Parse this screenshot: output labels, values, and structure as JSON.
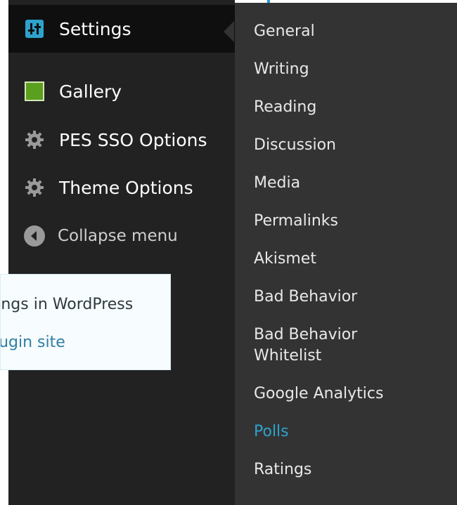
{
  "menu": {
    "items": [
      {
        "label": "Settings",
        "icon": "settings-sliders-icon",
        "active": true
      },
      {
        "label": "Gallery",
        "icon": "gallery-icon",
        "active": false
      },
      {
        "label": "PES SSO Options",
        "icon": "gear-icon",
        "active": false
      },
      {
        "label": "Theme Options",
        "icon": "gear-icon",
        "active": false
      }
    ],
    "collapse_label": "Collapse menu"
  },
  "submenu": {
    "items": [
      "General",
      "Writing",
      "Reading",
      "Discussion",
      "Media",
      "Permalinks",
      "Akismet",
      "Bad Behavior",
      "Bad Behavior",
      "Whitelist",
      "Google Analytics",
      "Polls",
      "Ratings"
    ],
    "current": "Polls"
  },
  "tooltip": {
    "text": "ttings in WordPress",
    "link": "plugin site"
  },
  "colors": {
    "menu_bg": "#222222",
    "active_bg": "#0f0f10",
    "submenu_bg": "#333333",
    "accent": "#2ea2cc",
    "tooltip_bg": "#f7fcfe"
  }
}
